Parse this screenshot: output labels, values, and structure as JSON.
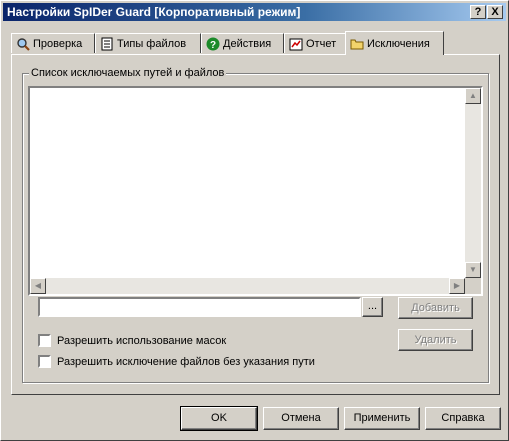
{
  "window": {
    "title": "Настройки SpIDer Guard [Корпоративный режим]",
    "help_btn": "?",
    "close_btn": "X"
  },
  "tabs": [
    {
      "label": "Проверка",
      "icon": "magnifier-icon"
    },
    {
      "label": "Типы файлов",
      "icon": "document-icon"
    },
    {
      "label": "Действия",
      "icon": "question-icon"
    },
    {
      "label": "Отчет",
      "icon": "report-icon"
    },
    {
      "label": "Исключения",
      "icon": "folder-icon",
      "active": true
    }
  ],
  "exclusions": {
    "group_label": "Список исключаемых путей и файлов",
    "list_items": [],
    "path_value": "",
    "browse_label": "...",
    "add_label": "Добавить",
    "remove_label": "Удалить",
    "allow_masks_label": "Разрешить использование масок",
    "allow_masks_checked": false,
    "allow_no_path_label": "Разрешить исключение файлов без указания пути",
    "allow_no_path_checked": false
  },
  "footer": {
    "ok": "OK",
    "cancel": "Отмена",
    "apply": "Применить",
    "help": "Справка"
  },
  "colors": {
    "face": "#d4d0c8",
    "title_start": "#0a246a",
    "title_end": "#a6caf0"
  }
}
